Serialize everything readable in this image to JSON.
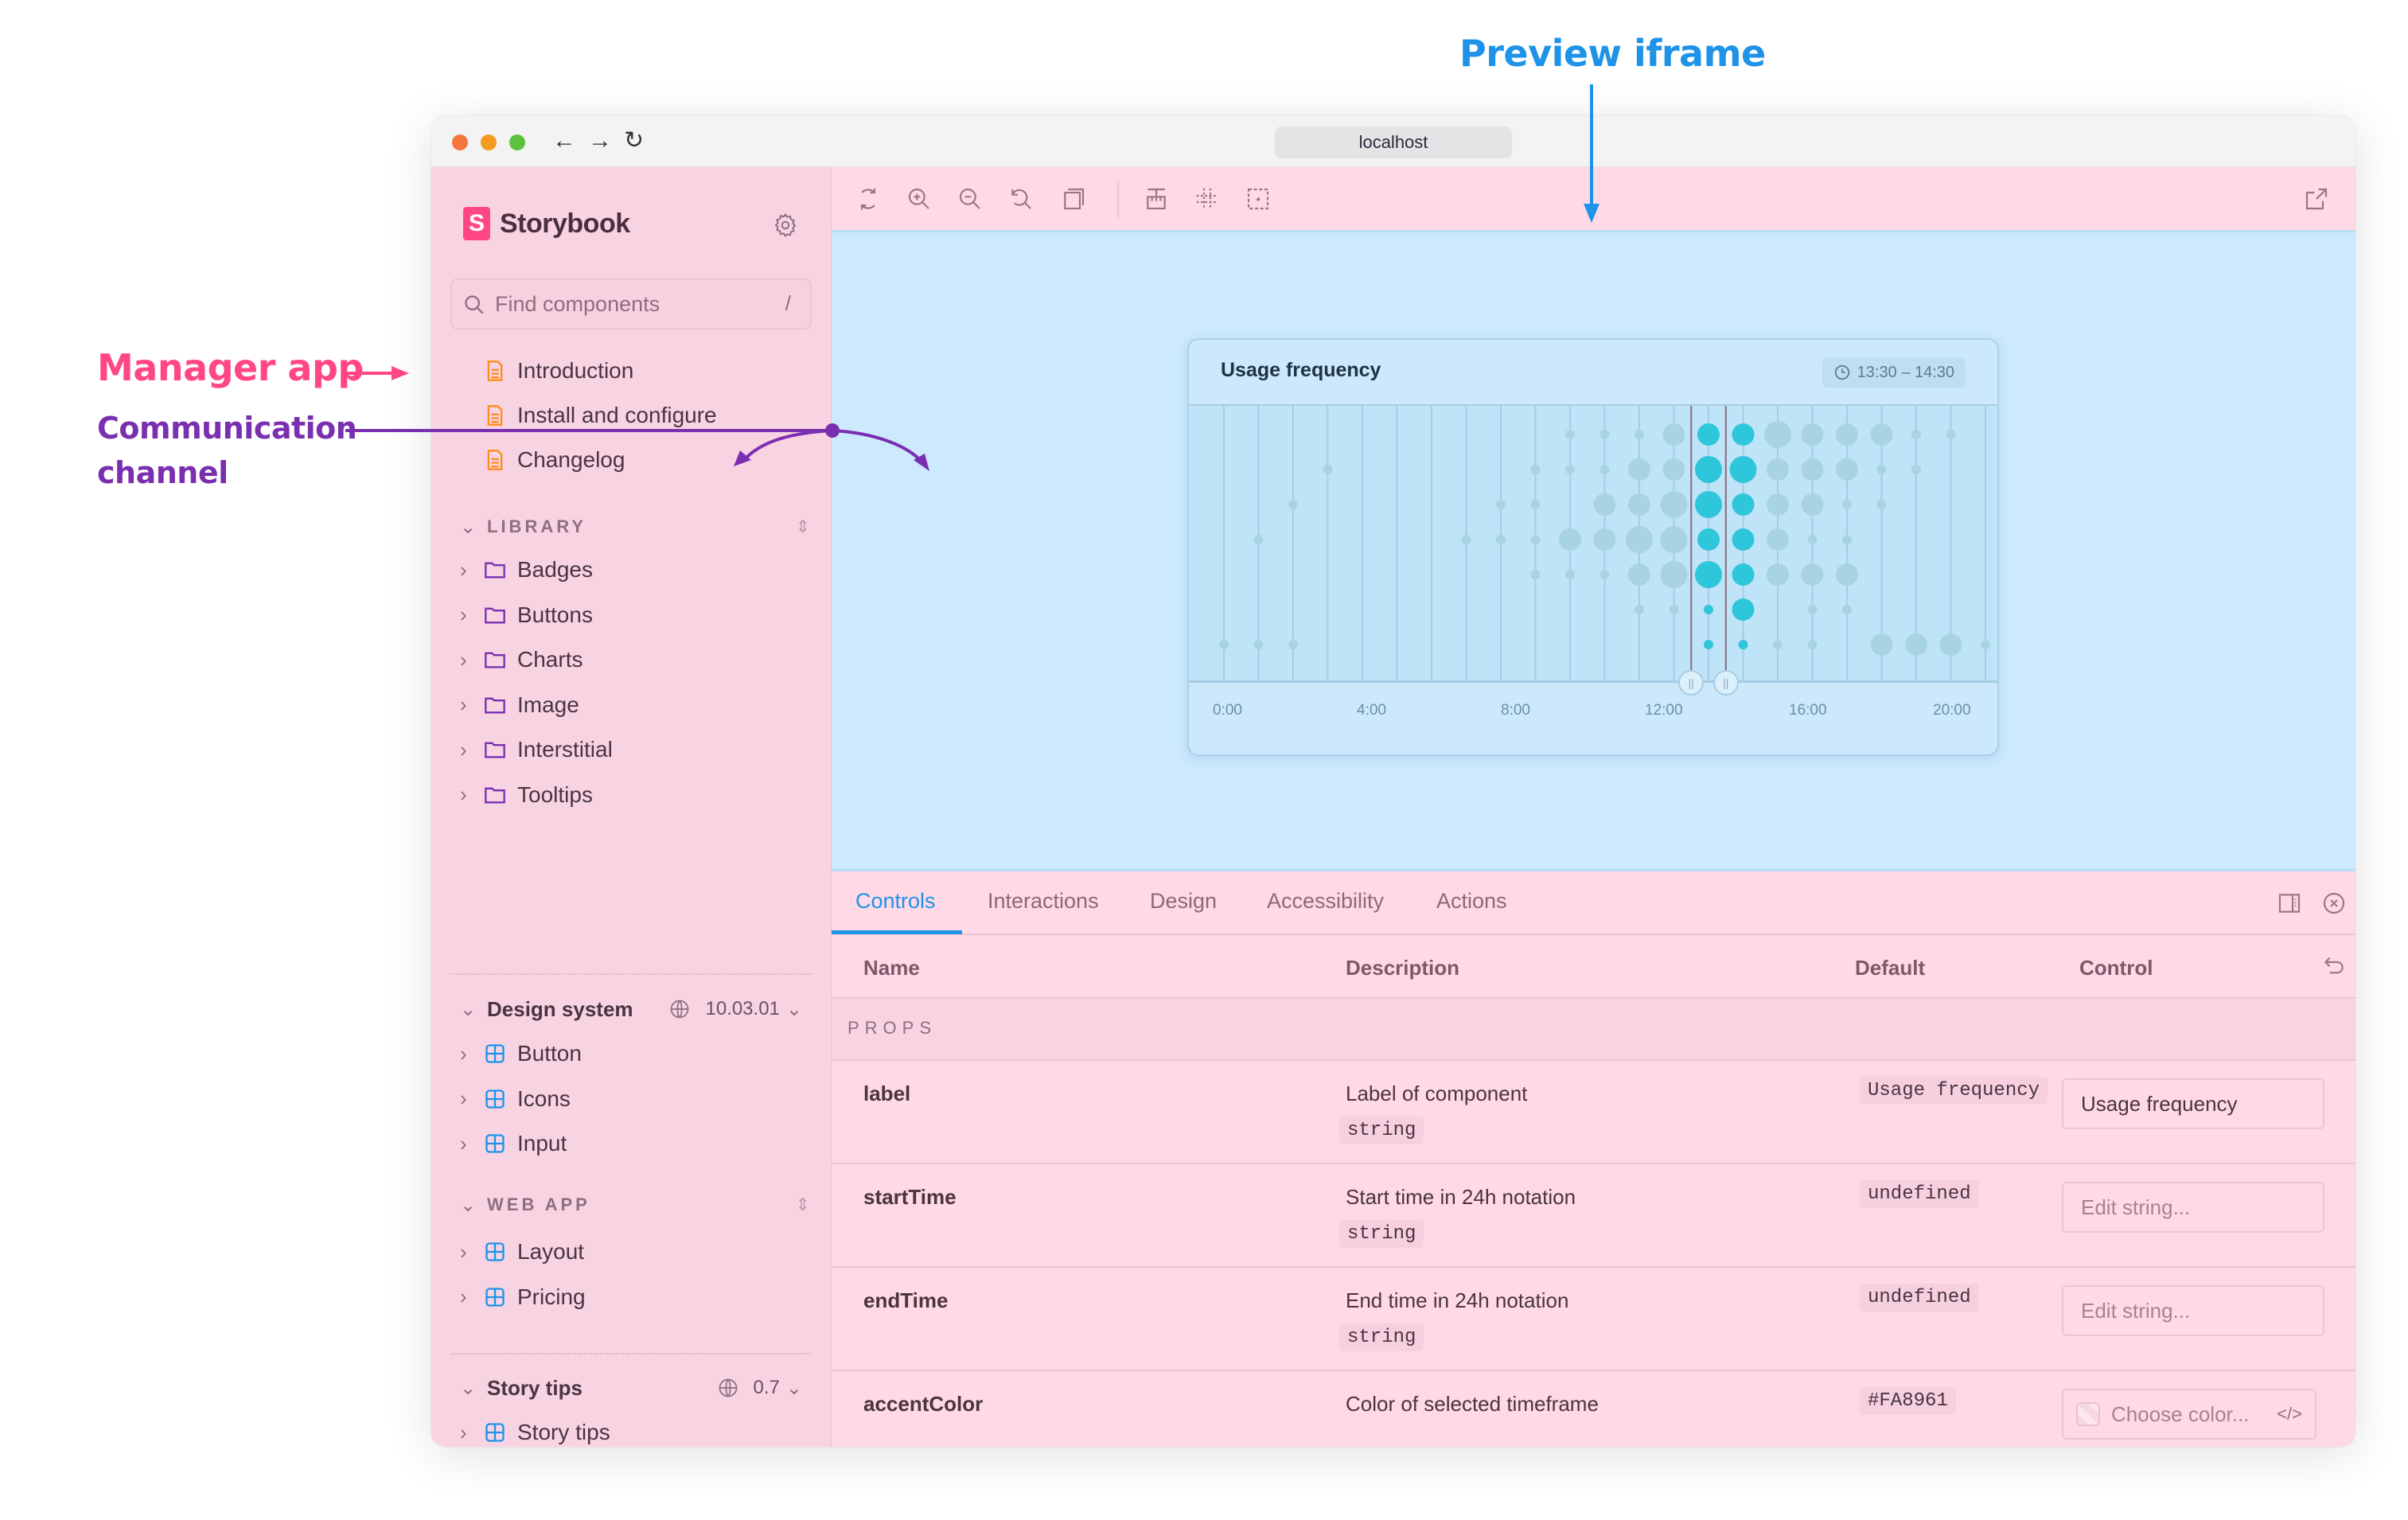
{
  "annotations": {
    "preview_iframe": "Preview iframe",
    "manager_app": "Manager app",
    "communication_channel_line1": "Communication",
    "communication_channel_line2": "channel",
    "colors": {
      "preview": "#1E93E8",
      "manager": "#FF4785",
      "channel": "#7A2FB0"
    }
  },
  "browser": {
    "url": "localhost",
    "traffic_lights": [
      "#F5763D",
      "#F39B1F",
      "#5CC13E"
    ],
    "nav": {
      "back": "←",
      "forward": "→",
      "reload": "↻"
    }
  },
  "sidebar": {
    "brand": {
      "logo_letter": "S",
      "name": "Storybook"
    },
    "search": {
      "placeholder": "Find components",
      "shortcut": "/"
    },
    "docs": [
      {
        "label": "Introduction",
        "icon": "document-icon"
      },
      {
        "label": "Install and configure",
        "icon": "document-icon"
      },
      {
        "label": "Changelog",
        "icon": "document-icon"
      }
    ],
    "library": {
      "title": "LIBRARY",
      "items": [
        {
          "label": "Badges",
          "icon": "folder-icon"
        },
        {
          "label": "Buttons",
          "icon": "folder-icon"
        },
        {
          "label": "Charts",
          "icon": "folder-icon"
        },
        {
          "label": "Image",
          "icon": "folder-icon"
        },
        {
          "label": "Interstitial",
          "icon": "folder-icon"
        },
        {
          "label": "Tooltips",
          "icon": "folder-icon"
        }
      ]
    },
    "design_system": {
      "title": "Design system",
      "version": "10.03.01",
      "items": [
        {
          "label": "Button",
          "icon": "component-icon"
        },
        {
          "label": "Icons",
          "icon": "component-icon"
        },
        {
          "label": "Input",
          "icon": "component-icon"
        }
      ]
    },
    "web_app": {
      "title": "WEB APP",
      "items": [
        {
          "label": "Layout",
          "icon": "component-icon"
        },
        {
          "label": "Pricing",
          "icon": "component-icon"
        }
      ]
    },
    "story_tips": {
      "title": "Story tips",
      "version": "0.7",
      "items": [
        {
          "label": "Story tips",
          "icon": "component-icon"
        }
      ]
    }
  },
  "toolbar": {
    "tools": [
      "remount-icon",
      "zoom-in-icon",
      "zoom-out-icon",
      "zoom-reset-icon",
      "background-icon",
      "measure-icon",
      "grid-icon",
      "outline-icon"
    ],
    "open_new_tab": "open-in-new-tab-icon"
  },
  "preview": {
    "card": {
      "title": "Usage frequency",
      "time_range": "13:30 – 14:30"
    }
  },
  "chart_data": {
    "type": "scatter",
    "title": "Usage frequency",
    "xlabel": "",
    "ylabel": "",
    "x_tick_labels": [
      "0:00",
      "4:00",
      "8:00",
      "12:00",
      "16:00",
      "20:00"
    ],
    "xlim": [
      0,
      23
    ],
    "ylim": [
      1,
      7
    ],
    "selected_range": {
      "start": "13:30",
      "end": "14:30"
    },
    "colors": {
      "selected": "#2EC6DA",
      "unselected": "#A8D3E3"
    },
    "points_note": "Each point: hour column, row (1=top..7=bottom), size 1-3",
    "points": [
      [
        0,
        7,
        1
      ],
      [
        1,
        4,
        1
      ],
      [
        1,
        7,
        1
      ],
      [
        2,
        3,
        1
      ],
      [
        2,
        7,
        1
      ],
      [
        3,
        2,
        1
      ],
      [
        7,
        4,
        1
      ],
      [
        8,
        3,
        1
      ],
      [
        8,
        4,
        1
      ],
      [
        9,
        2,
        1
      ],
      [
        9,
        3,
        1
      ],
      [
        9,
        4,
        1
      ],
      [
        9,
        5,
        1
      ],
      [
        10,
        1,
        1
      ],
      [
        10,
        2,
        1
      ],
      [
        10,
        4,
        2
      ],
      [
        10,
        5,
        1
      ],
      [
        11,
        1,
        1
      ],
      [
        11,
        2,
        1
      ],
      [
        11,
        3,
        2
      ],
      [
        11,
        4,
        2
      ],
      [
        11,
        5,
        1
      ],
      [
        12,
        1,
        1
      ],
      [
        12,
        2,
        2
      ],
      [
        12,
        3,
        2
      ],
      [
        12,
        4,
        3
      ],
      [
        12,
        5,
        2
      ],
      [
        12,
        6,
        1
      ],
      [
        13,
        1,
        2
      ],
      [
        13,
        2,
        2
      ],
      [
        13,
        3,
        3
      ],
      [
        13,
        4,
        3
      ],
      [
        13,
        5,
        3
      ],
      [
        13,
        6,
        1
      ],
      [
        14,
        1,
        2
      ],
      [
        14,
        2,
        3
      ],
      [
        14,
        3,
        3
      ],
      [
        14,
        4,
        2
      ],
      [
        14,
        5,
        3
      ],
      [
        14,
        6,
        1
      ],
      [
        14,
        7,
        1
      ],
      [
        15,
        1,
        2
      ],
      [
        15,
        2,
        3
      ],
      [
        15,
        3,
        2
      ],
      [
        15,
        4,
        2
      ],
      [
        15,
        5,
        2
      ],
      [
        15,
        6,
        2
      ],
      [
        15,
        7,
        1
      ],
      [
        16,
        1,
        3
      ],
      [
        16,
        2,
        2
      ],
      [
        16,
        3,
        2
      ],
      [
        16,
        4,
        2
      ],
      [
        16,
        5,
        2
      ],
      [
        16,
        7,
        1
      ],
      [
        17,
        1,
        2
      ],
      [
        17,
        2,
        2
      ],
      [
        17,
        3,
        2
      ],
      [
        17,
        4,
        1
      ],
      [
        17,
        5,
        2
      ],
      [
        17,
        6,
        1
      ],
      [
        17,
        7,
        1
      ],
      [
        18,
        1,
        2
      ],
      [
        18,
        2,
        2
      ],
      [
        18,
        3,
        1
      ],
      [
        18,
        4,
        1
      ],
      [
        18,
        5,
        2
      ],
      [
        18,
        6,
        1
      ],
      [
        19,
        1,
        2
      ],
      [
        19,
        2,
        1
      ],
      [
        19,
        3,
        1
      ],
      [
        19,
        7,
        2
      ],
      [
        20,
        1,
        1
      ],
      [
        20,
        2,
        1
      ],
      [
        20,
        7,
        2
      ],
      [
        21,
        1,
        1
      ],
      [
        21,
        7,
        2
      ],
      [
        22,
        7,
        1
      ]
    ],
    "selected_columns": [
      14,
      15
    ]
  },
  "panel": {
    "tabs": [
      {
        "label": "Controls",
        "active": true
      },
      {
        "label": "Interactions",
        "active": false
      },
      {
        "label": "Design",
        "active": false
      },
      {
        "label": "Accessibility",
        "active": false
      },
      {
        "label": "Actions",
        "active": false
      }
    ],
    "columns": [
      "Name",
      "Description",
      "Default",
      "Control"
    ],
    "section": "PROPS",
    "rows": [
      {
        "name": "label",
        "description": "Label of component",
        "type": "string",
        "default": "Usage frequency",
        "control": {
          "kind": "text",
          "value": "Usage frequency",
          "placeholder": "Edit string..."
        }
      },
      {
        "name": "startTime",
        "description": "Start time in 24h notation",
        "type": "string",
        "default": "undefined",
        "control": {
          "kind": "text",
          "value": "",
          "placeholder": "Edit string..."
        }
      },
      {
        "name": "endTime",
        "description": "End time in 24h notation",
        "type": "string",
        "default": "undefined",
        "control": {
          "kind": "text",
          "value": "",
          "placeholder": "Edit string..."
        }
      },
      {
        "name": "accentColor",
        "description": "Color of selected timeframe",
        "type": "",
        "default": "#FA8961",
        "control": {
          "kind": "color",
          "placeholder": "Choose color...",
          "toggle": "</>"
        }
      }
    ]
  }
}
